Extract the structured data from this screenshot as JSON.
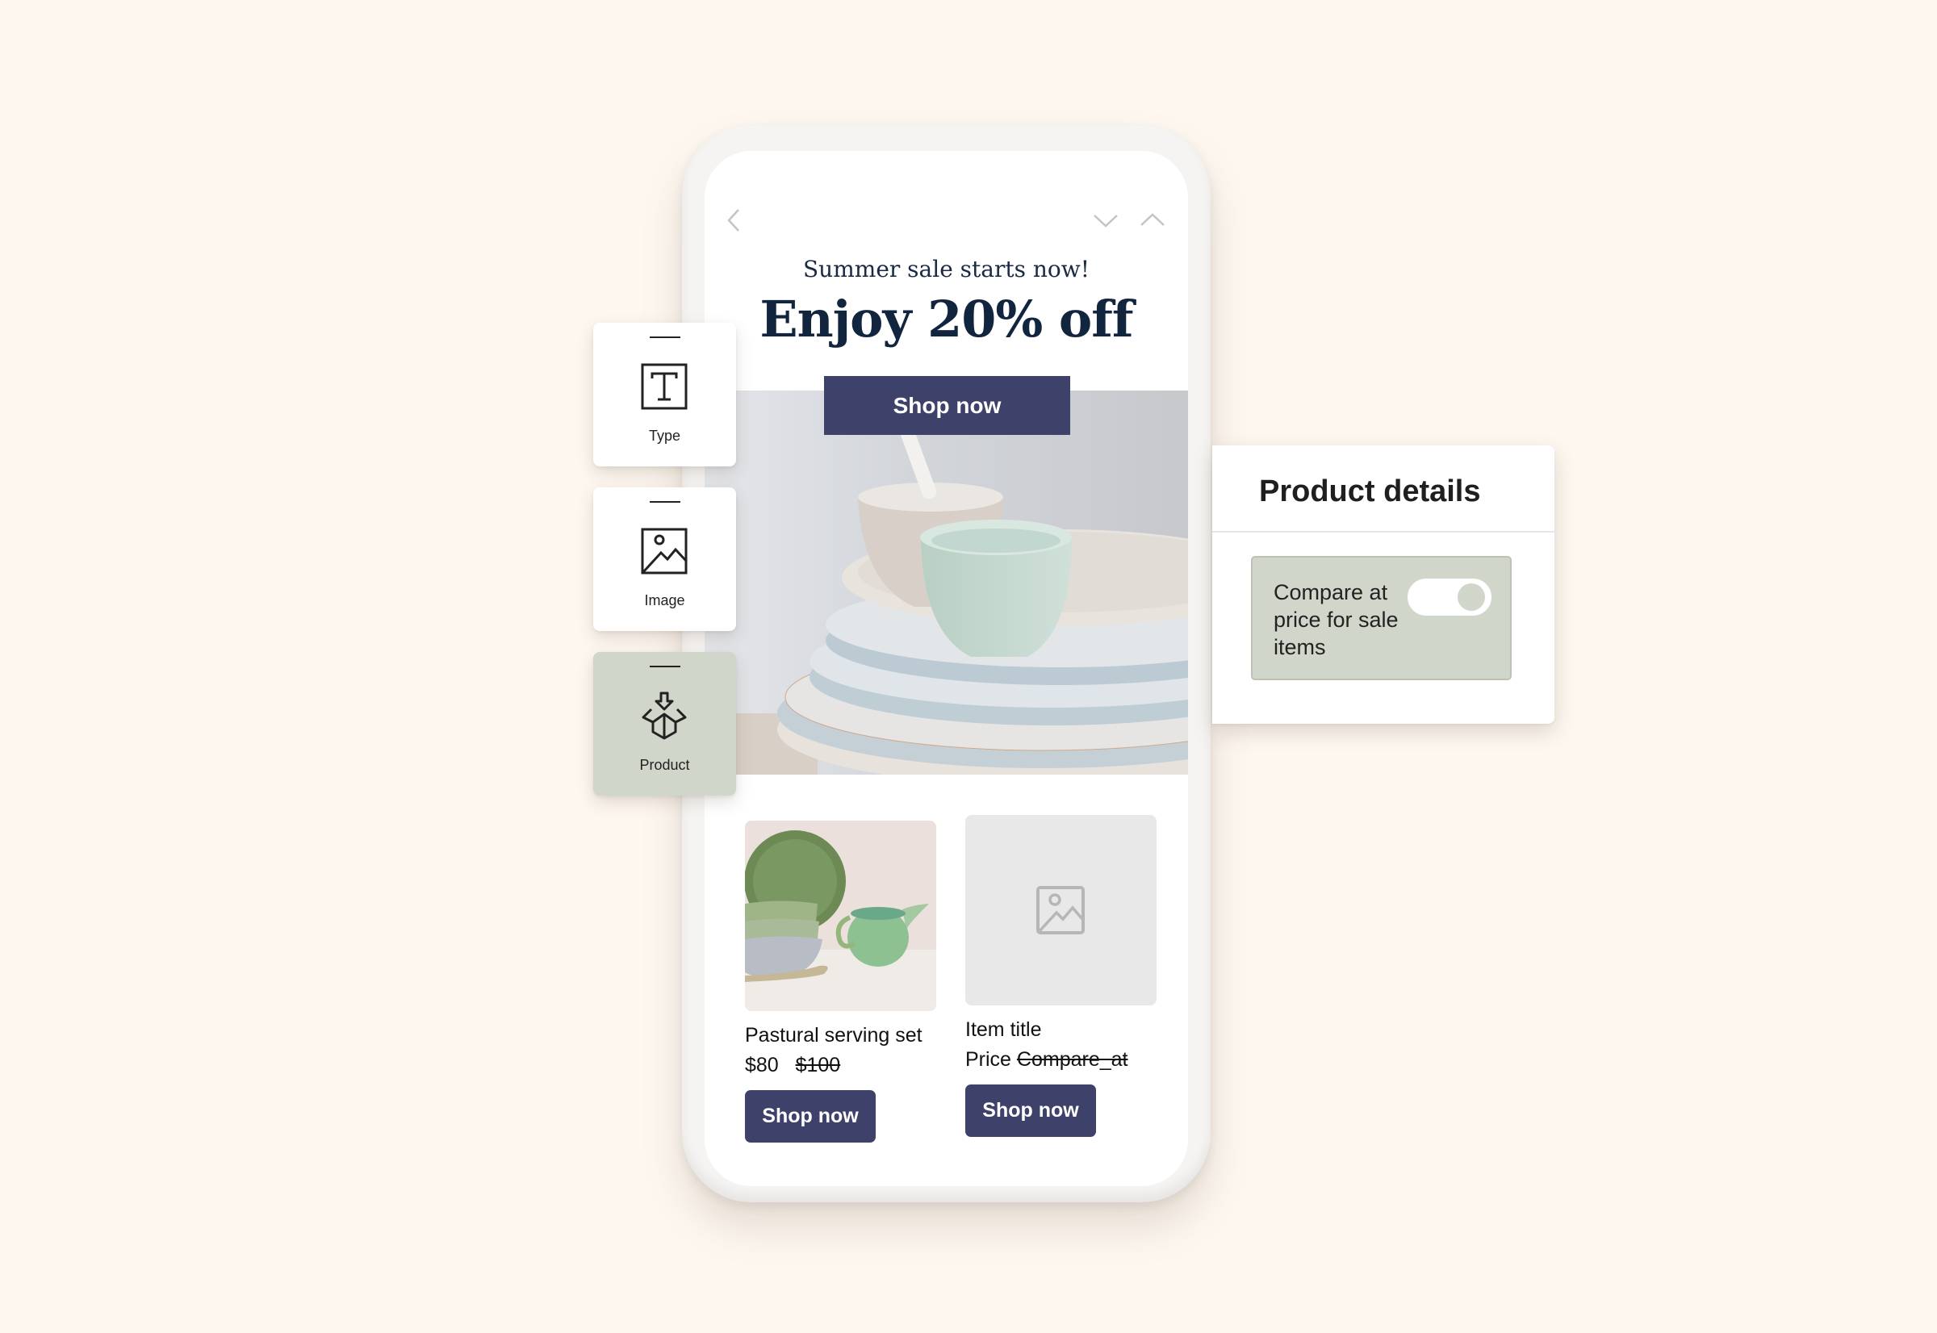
{
  "phone": {
    "nav": {
      "back_icon": "chevron-left-icon",
      "down_icon": "chevron-down-icon",
      "up_icon": "chevron-up-icon"
    },
    "hero": {
      "subheading": "Summer sale starts now!",
      "headline": "Enjoy 20% off",
      "button_label": "Shop now"
    },
    "products": [
      {
        "title": "Pastural serving set",
        "price": "$80",
        "compare_at": "$100",
        "button_label": "Shop now",
        "image": "green-ceramic-bowls-and-pitcher"
      },
      {
        "title": "Item title",
        "price": "Price",
        "compare_at": "Compare_at",
        "button_label": "Shop now",
        "image": "image-placeholder-icon"
      }
    ]
  },
  "tools": [
    {
      "label": "Type",
      "icon": "type-icon",
      "active": false
    },
    {
      "label": "Image",
      "icon": "image-icon",
      "active": false
    },
    {
      "label": "Product",
      "icon": "product-box-icon",
      "active": true
    }
  ],
  "product_details": {
    "title": "Product details",
    "option_label": "Compare at price for sale items",
    "toggle_on": true
  },
  "colors": {
    "background": "#fdf7f0",
    "button": "#3e426a",
    "headline": "#12253f",
    "sage": "#d1d6ca"
  }
}
